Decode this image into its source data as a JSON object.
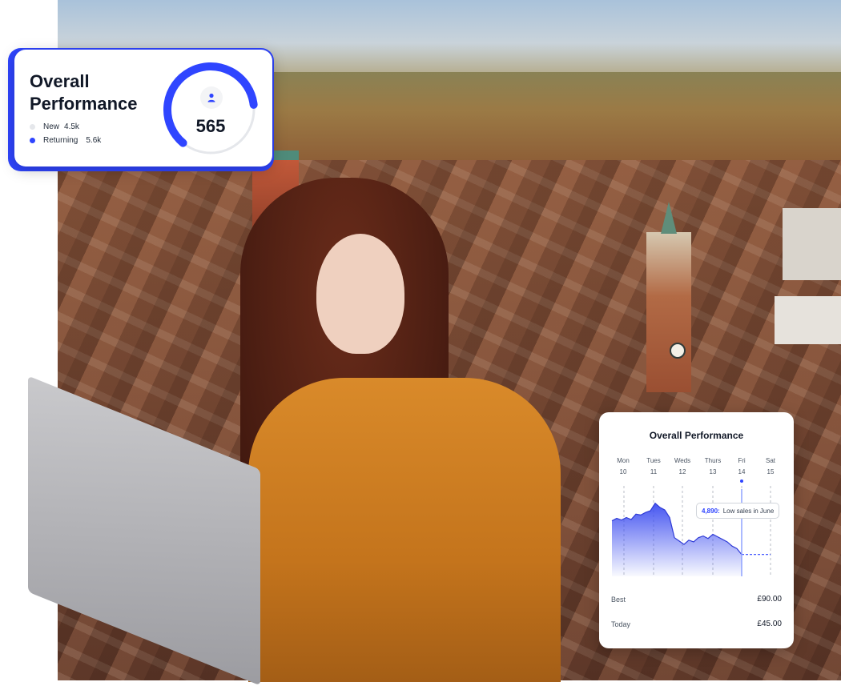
{
  "performance_card": {
    "title": "Overall Performance",
    "legend": [
      {
        "label": "New",
        "value": "4.5k",
        "color": "#e5e7eb"
      },
      {
        "label": "Returning",
        "value": "5.6k",
        "color": "#2f45ff"
      }
    ],
    "gauge": {
      "value": "565",
      "icon": "user-icon",
      "fill_fraction": 0.62
    }
  },
  "chart_card": {
    "title": "Overall Performance",
    "days": [
      {
        "day": "Mon",
        "date": "10"
      },
      {
        "day": "Tues",
        "date": "11"
      },
      {
        "day": "Weds",
        "date": "12"
      },
      {
        "day": "Thurs",
        "date": "13"
      },
      {
        "day": "Fri",
        "date": "14"
      },
      {
        "day": "Sat",
        "date": "15"
      }
    ],
    "tooltip": {
      "value": "4,890:",
      "text": "Low sales in June"
    },
    "stats": [
      {
        "label": "Best",
        "value": "£90.00"
      },
      {
        "label": "Today",
        "value": "£45.00"
      }
    ]
  },
  "colors": {
    "accent": "#2f45ff",
    "gauge_track": "#e5e7eb"
  },
  "chart_data": {
    "type": "area",
    "title": "Overall Performance",
    "categories": [
      "Mon 10",
      "Tues 11",
      "Weds 12",
      "Thurs 13",
      "Fri 14",
      "Sat 15"
    ],
    "values": [
      5600,
      6200,
      4200,
      4500,
      4890,
      4890
    ],
    "highlight": {
      "category": "Fri 14",
      "value": 4890,
      "label": "Low sales in June"
    },
    "grid": true
  }
}
